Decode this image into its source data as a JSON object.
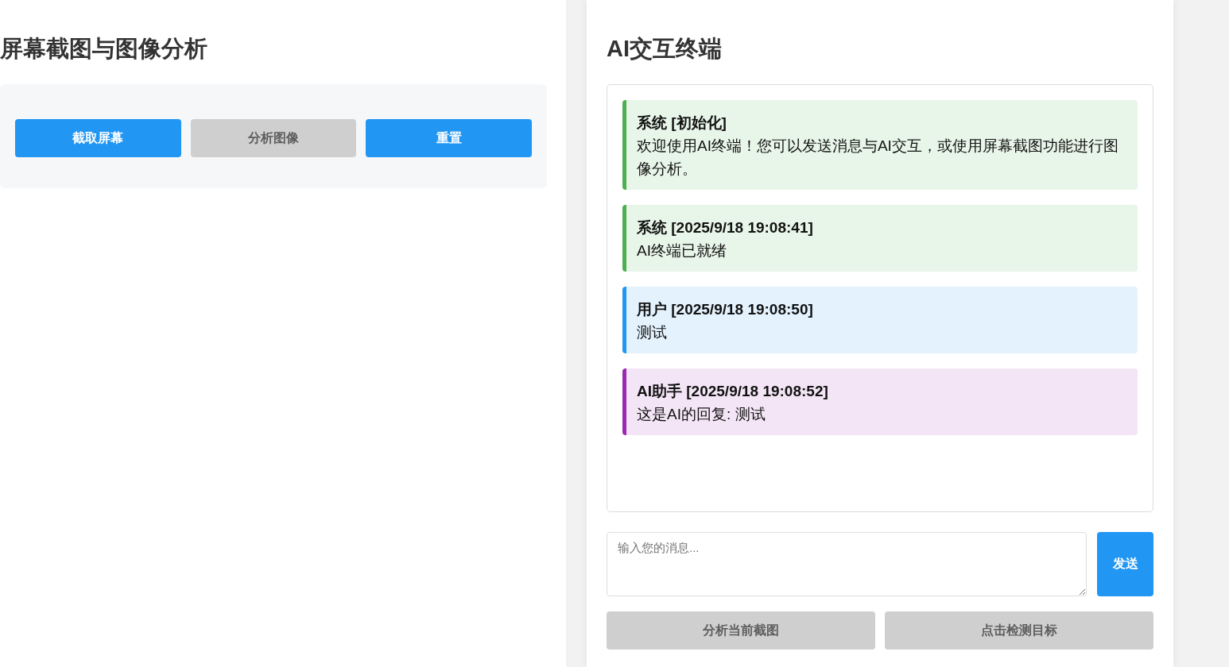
{
  "left_panel": {
    "title": "屏幕截图与图像分析",
    "buttons": [
      {
        "label": "截取屏幕",
        "disabled": false
      },
      {
        "label": "分析图像",
        "disabled": true
      },
      {
        "label": "重置",
        "disabled": false
      }
    ]
  },
  "terminal": {
    "title": "AI交互终端",
    "messages": [
      {
        "kind": "system",
        "header": "系统 [初始化]",
        "text": "欢迎使用AI终端！您可以发送消息与AI交互，或使用屏幕截图功能进行图像分析。"
      },
      {
        "kind": "system",
        "header": "系统 [2025/9/18 19:08:41]",
        "text": "AI终端已就绪"
      },
      {
        "kind": "user",
        "header": "用户 [2025/9/18 19:08:50]",
        "text": "测试"
      },
      {
        "kind": "ai",
        "header": "AI助手 [2025/9/18 19:08:52]",
        "text": "这是AI的回复: 测试"
      }
    ],
    "input": {
      "placeholder": "输入您的消息..."
    },
    "send_button": {
      "label": "发送",
      "disabled": false
    },
    "action_buttons": [
      {
        "label": "分析当前截图",
        "disabled": true
      },
      {
        "label": "点击检测目标",
        "disabled": true
      }
    ]
  }
}
